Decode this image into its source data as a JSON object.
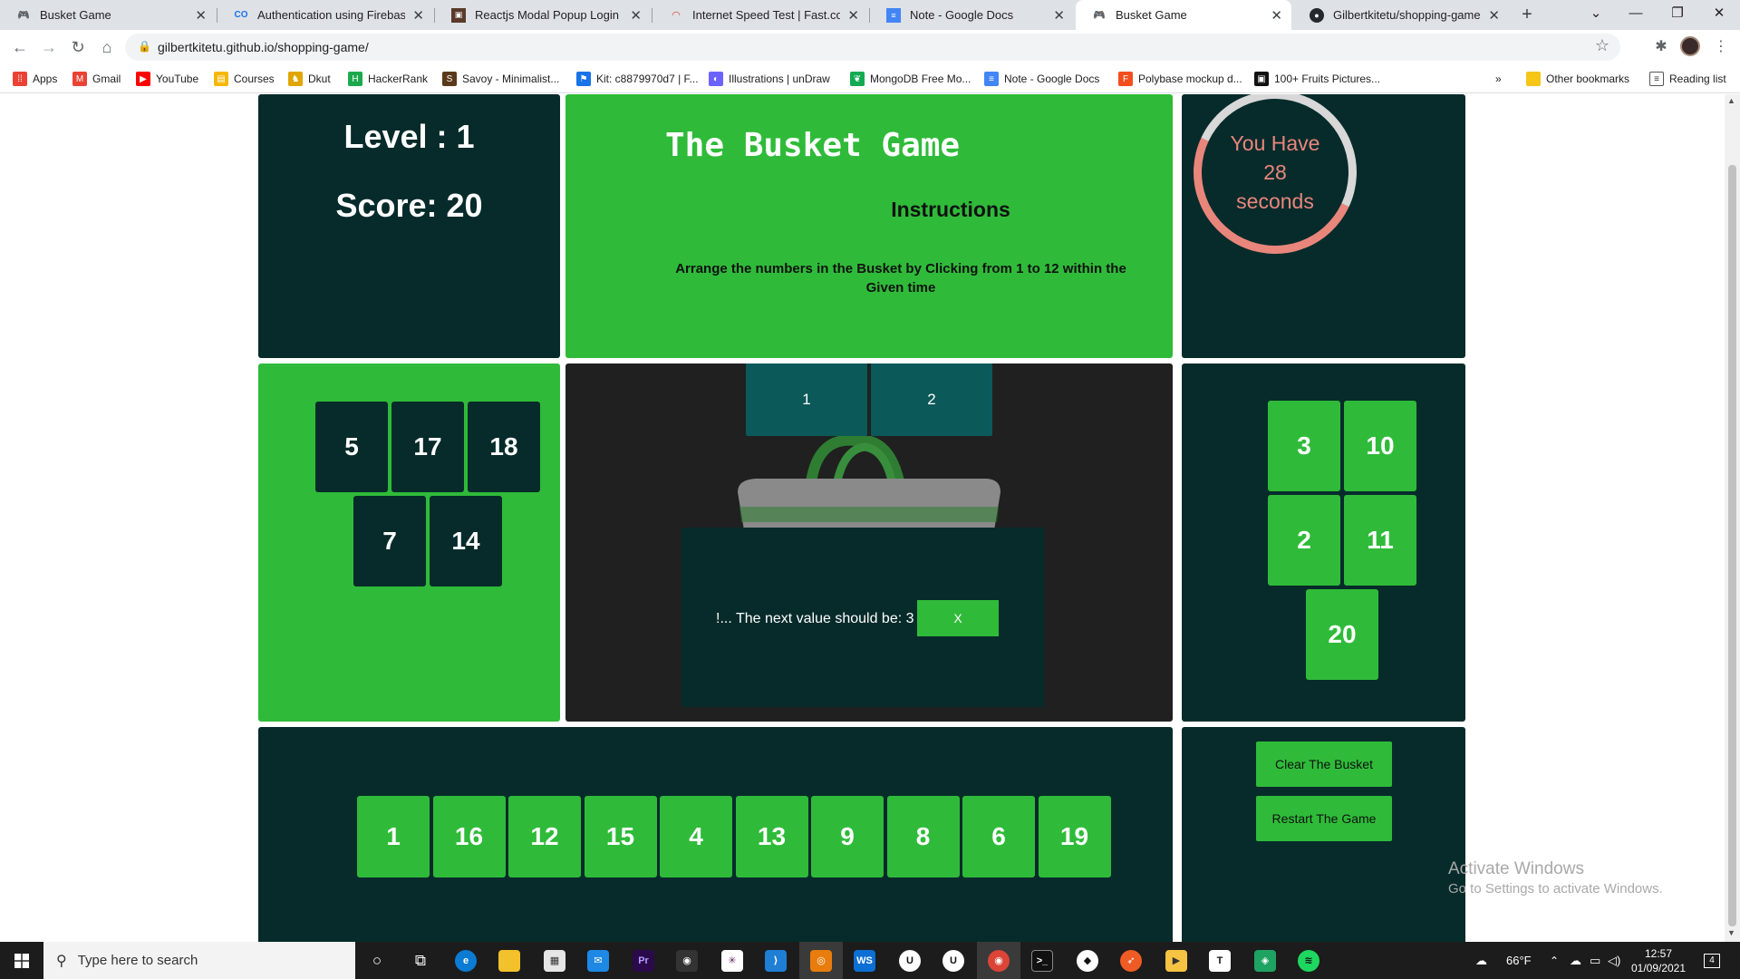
{
  "browser": {
    "tabs": [
      {
        "title": "Busket Game",
        "icon": "game-controller-icon",
        "active": false
      },
      {
        "title": "Authentication using Firebase and",
        "icon": "colab-icon",
        "active": false
      },
      {
        "title": "Reactjs Modal Popup Login Form",
        "icon": "video-icon",
        "active": false
      },
      {
        "title": "Internet Speed Test | Fast.com",
        "icon": "speed-gauge-icon",
        "active": false
      },
      {
        "title": "Note - Google Docs",
        "icon": "docs-icon",
        "active": false
      },
      {
        "title": "Busket Game",
        "icon": "game-controller-icon",
        "active": true
      },
      {
        "title": "Gilbertkitetu/shopping-game",
        "icon": "github-icon",
        "active": false
      }
    ],
    "url": "gilbertkitetu.github.io/shopping-game/",
    "bookmarks": [
      {
        "label": "Apps",
        "icon": "apps-grid-icon",
        "color": "#ea4335"
      },
      {
        "label": "Gmail",
        "icon": "gmail-icon",
        "color": "#ea4335"
      },
      {
        "label": "YouTube",
        "icon": "youtube-icon",
        "color": "#ff0000"
      },
      {
        "label": "Courses",
        "icon": "classroom-icon",
        "color": "#f6b704"
      },
      {
        "label": "Dkut",
        "icon": "crest-icon",
        "color": "#e0a500"
      },
      {
        "label": "HackerRank",
        "icon": "hackerrank-icon",
        "color": "#1ba94c"
      },
      {
        "label": "Savoy - Minimalist...",
        "icon": "savoy-icon",
        "color": "#5a3a1a"
      },
      {
        "label": "Kit: c8879970d7 | F...",
        "icon": "flag-icon",
        "color": "#1a73e8"
      },
      {
        "label": "Illustrations | unDraw",
        "icon": "undraw-icon",
        "color": "#6c63ff"
      },
      {
        "label": "MongoDB Free Mo...",
        "icon": "leaf-icon",
        "color": "#13aa52"
      },
      {
        "label": "Note - Google Docs",
        "icon": "docs-icon",
        "color": "#4285f4"
      },
      {
        "label": "Polybase mockup d...",
        "icon": "figma-icon",
        "color": "#f24e1e"
      },
      {
        "label": "100+ Fruits Pictures...",
        "icon": "unsplash-icon",
        "color": "#111111"
      }
    ],
    "other_bookmarks": "Other bookmarks",
    "reading_list": "Reading list"
  },
  "game": {
    "level_label": "Level : 1",
    "score_label": "Score: 20",
    "title": "The Busket Game",
    "instructions_title": "Instructions",
    "instructions_text": "Arrange the numbers in the Busket by Clicking from 1 to 12 within the Given time",
    "timer_prefix": "You Have",
    "timer_value": "28",
    "timer_suffix": "seconds",
    "busket_items": [
      "1",
      "2"
    ],
    "left_tiles": [
      "5",
      "17",
      "18",
      "7",
      "14"
    ],
    "right_tiles": [
      "3",
      "10",
      "2",
      "11",
      "20"
    ],
    "bottom_tiles": [
      "1",
      "16",
      "12",
      "15",
      "4",
      "13",
      "9",
      "8",
      "6",
      "19"
    ],
    "modal_message": "!... The next value should be: 3",
    "modal_close": "X",
    "clear_button": "Clear The Busket",
    "restart_button": "Restart The Game",
    "colors": {
      "dark_panel": "#072b2b",
      "green": "#2fbb39",
      "slot": "#0b5959",
      "timer": "#e8867c"
    }
  },
  "windows": {
    "activate_title": "Activate Windows",
    "activate_sub": "Go to Settings to activate Windows.",
    "search_placeholder": "Type here to search",
    "weather": "66°F",
    "time": "12:57",
    "date": "01/09/2021",
    "notification_count": "4"
  }
}
